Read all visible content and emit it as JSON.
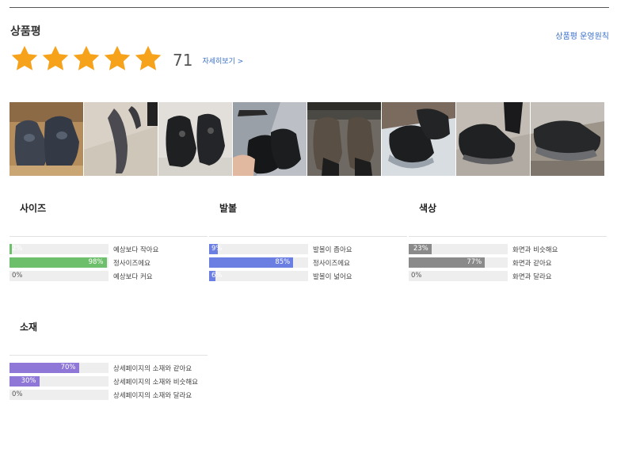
{
  "header": {
    "title": "상품평",
    "policy_link": "상품평 운영원칙"
  },
  "rating": {
    "stars_filled": 5,
    "stars_total": 5,
    "review_count": "71",
    "details_link": "자세히보기 >",
    "star_color": "#f7a21b"
  },
  "photos": [
    {
      "id": "photo-1"
    },
    {
      "id": "photo-2"
    },
    {
      "id": "photo-3"
    },
    {
      "id": "photo-4"
    },
    {
      "id": "photo-5"
    },
    {
      "id": "photo-6"
    },
    {
      "id": "photo-7"
    },
    {
      "id": "photo-8"
    }
  ],
  "sections": [
    {
      "key": "size",
      "title": "사이즈",
      "color": "#6dbf6b",
      "rows": [
        {
          "percent": 2,
          "text": "2%",
          "label": "예상보다 작아요"
        },
        {
          "percent": 98,
          "text": "98%",
          "label": "정사이즈에요"
        },
        {
          "percent": 0,
          "text": "0%",
          "label": "예상보다 커요"
        }
      ]
    },
    {
      "key": "width",
      "title": "발볼",
      "color": "#6b7fe3",
      "rows": [
        {
          "percent": 9,
          "text": "9%",
          "label": "발볼이 좁아요"
        },
        {
          "percent": 85,
          "text": "85%",
          "label": "정사이즈에요"
        },
        {
          "percent": 6,
          "text": "6%",
          "label": "발볼이 넓어요"
        }
      ]
    },
    {
      "key": "color",
      "title": "색상",
      "color": "#8a8a8a",
      "rows": [
        {
          "percent": 23,
          "text": "23%",
          "label": "화면과 비슷해요"
        },
        {
          "percent": 77,
          "text": "77%",
          "label": "화면과 같아요"
        },
        {
          "percent": 0,
          "text": "0%",
          "label": "화면과 달라요"
        }
      ]
    },
    {
      "key": "material",
      "title": "소재",
      "color": "#8e77d6",
      "rows": [
        {
          "percent": 70,
          "text": "70%",
          "label": "상세페이지의 소재와 같아요"
        },
        {
          "percent": 30,
          "text": "30%",
          "label": "상세페이지의 소재와 비슷해요"
        },
        {
          "percent": 0,
          "text": "0%",
          "label": "상세페이지의 소재와 달라요"
        }
      ]
    }
  ]
}
